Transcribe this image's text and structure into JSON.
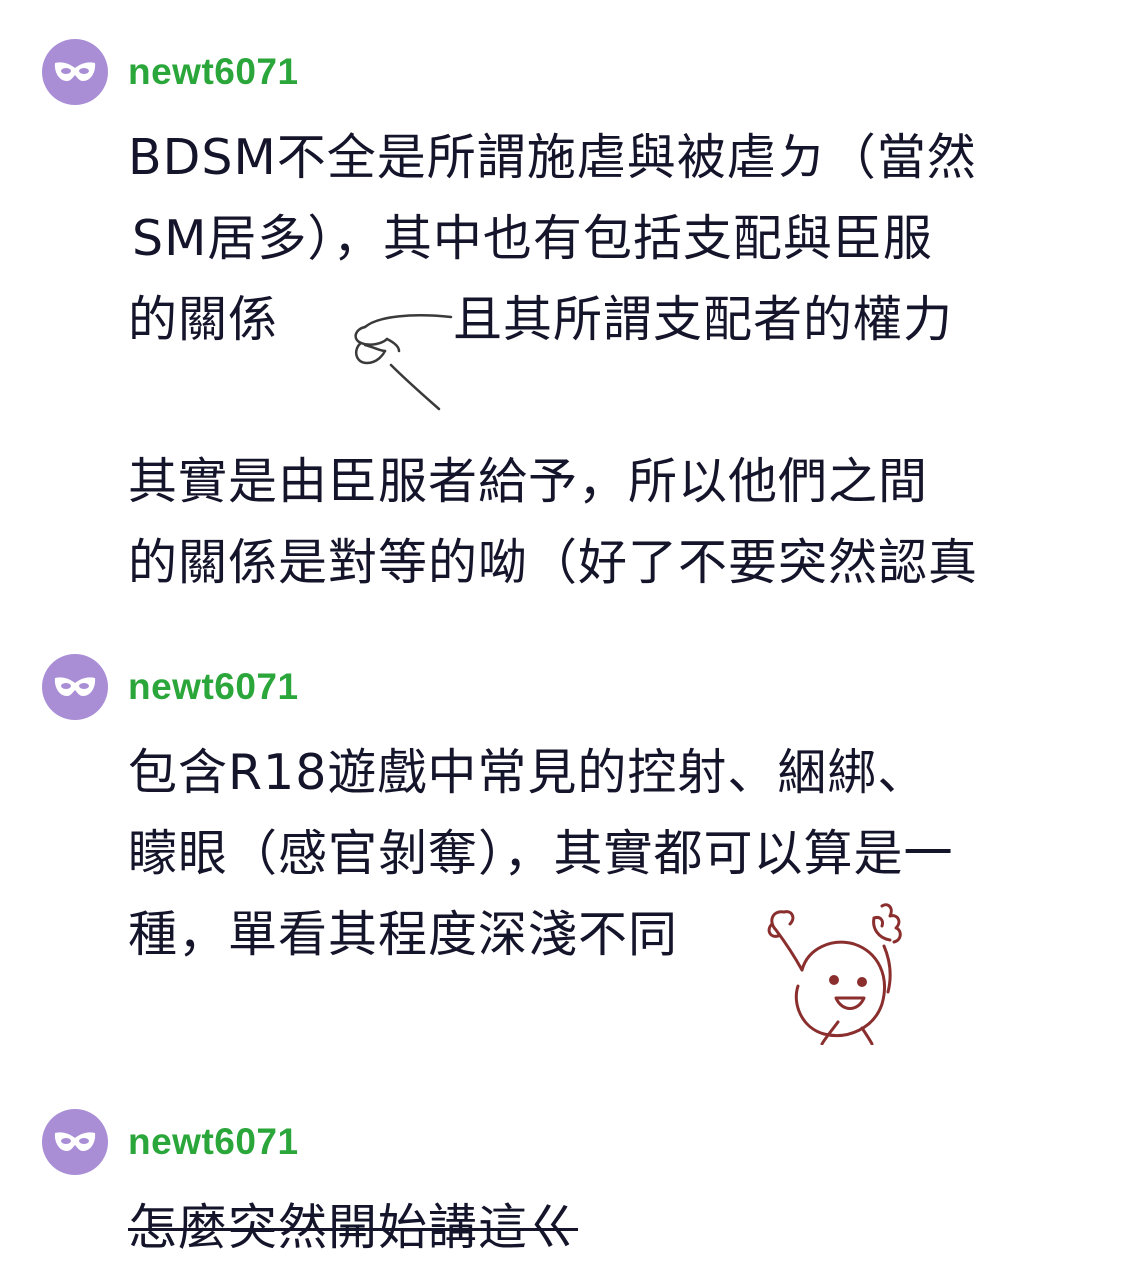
{
  "theme": {
    "avatar_bg": "#a98ed6",
    "avatar_icon": "#ffffff",
    "username_color": "#2aa63a",
    "text_color": "#14142b"
  },
  "comments": [
    {
      "avatar_icon": "masquerade-mask-icon",
      "username": "newt6071",
      "lines": [
        "BDSM不全是所謂施虐與被虐ㄉ（當然",
        "SM居多），其中也有包括支配與臣服",
        "的關係",
        "且其所謂支配者的權力",
        "",
        "其實是由臣服者給予，所以他們之間",
        "的關係是對等的呦（好了不要突然認真"
      ],
      "sticker": "pointing-hand-doodle-icon"
    },
    {
      "avatar_icon": "masquerade-mask-icon",
      "username": "newt6071",
      "lines": [
        "包含R18遊戲中常見的控射、綑綁、",
        "矇眼（感官剝奪），其實都可以算是一",
        "種，單看其程度深淺不同"
      ],
      "sticker": "cheering-blob-doodle-icon"
    },
    {
      "avatar_icon": "masquerade-mask-icon",
      "username": "newt6071",
      "lines": [
        "怎麼突然開始講這ㄍ"
      ],
      "strikethrough": true
    }
  ]
}
